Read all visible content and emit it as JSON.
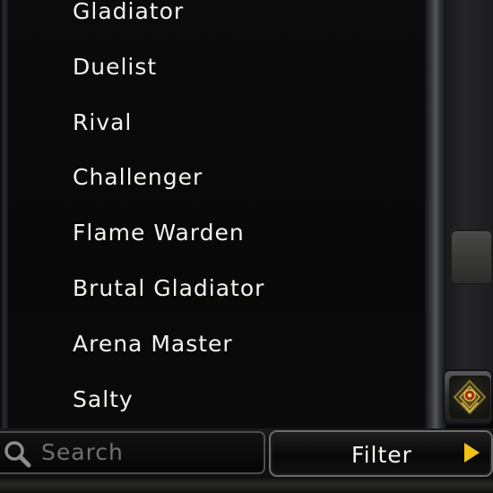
{
  "list": {
    "items": [
      {
        "label": "Gladiator"
      },
      {
        "label": "Duelist"
      },
      {
        "label": "Rival"
      },
      {
        "label": "Challenger"
      },
      {
        "label": "Flame Warden"
      },
      {
        "label": "Brutal Gladiator"
      },
      {
        "label": "Arena Master"
      },
      {
        "label": "Salty"
      }
    ]
  },
  "search": {
    "placeholder": "Search",
    "value": ""
  },
  "filter": {
    "label": "Filter",
    "arrow_color": "#f0c214"
  },
  "icons": {
    "search": "search-icon",
    "filter_arrow": "triangle-right-icon",
    "scroll_button": "eye-emblem-icon"
  },
  "colors": {
    "text": "#f4f2ec",
    "placeholder": "#707070",
    "accent": "#f0c214"
  }
}
